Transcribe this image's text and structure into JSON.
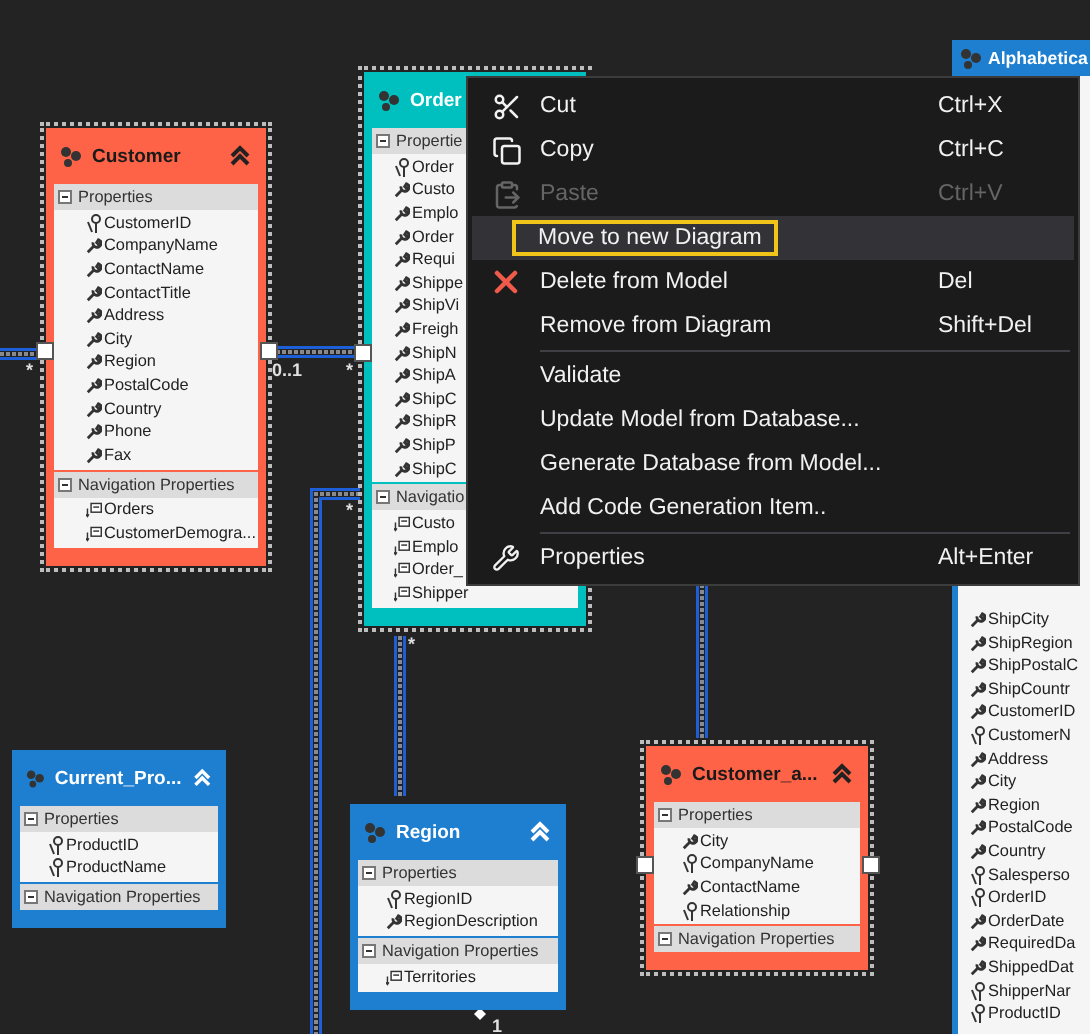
{
  "entities": [
    {
      "title": "Customer",
      "color": "#ff6347",
      "selected": true,
      "collapse_button": true,
      "sections": [
        {
          "label": "Properties",
          "rows": [
            {
              "text": "CustomerID",
              "kind": "key"
            },
            {
              "text": "CompanyName",
              "kind": "scalar"
            },
            {
              "text": "ContactName",
              "kind": "scalar"
            },
            {
              "text": "ContactTitle",
              "kind": "scalar"
            },
            {
              "text": "Address",
              "kind": "scalar"
            },
            {
              "text": "City",
              "kind": "scalar"
            },
            {
              "text": "Region",
              "kind": "scalar"
            },
            {
              "text": "PostalCode",
              "kind": "scalar"
            },
            {
              "text": "Country",
              "kind": "scalar"
            },
            {
              "text": "Phone",
              "kind": "scalar"
            },
            {
              "text": "Fax",
              "kind": "scalar"
            }
          ]
        },
        {
          "label": "Navigation Properties",
          "rows": [
            {
              "text": "Orders",
              "kind": "nav"
            },
            {
              "text": "CustomerDemogra...",
              "kind": "nav"
            }
          ]
        }
      ]
    },
    {
      "title": "Order",
      "color": "#00bfbf",
      "selected": true,
      "collapse_button": false,
      "sections": [
        {
          "label": "Propertie",
          "rows": [
            {
              "text": "Order",
              "kind": "key"
            },
            {
              "text": "Custo",
              "kind": "scalar"
            },
            {
              "text": "Emplo",
              "kind": "scalar"
            },
            {
              "text": "Order",
              "kind": "scalar"
            },
            {
              "text": "Requi",
              "kind": "scalar"
            },
            {
              "text": "Shippe",
              "kind": "scalar"
            },
            {
              "text": "ShipVi",
              "kind": "scalar"
            },
            {
              "text": "Freigh",
              "kind": "scalar"
            },
            {
              "text": "ShipN",
              "kind": "scalar"
            },
            {
              "text": "ShipA",
              "kind": "scalar"
            },
            {
              "text": "ShipC",
              "kind": "scalar"
            },
            {
              "text": "ShipR",
              "kind": "scalar"
            },
            {
              "text": "ShipP",
              "kind": "scalar"
            },
            {
              "text": "ShipC",
              "kind": "scalar"
            }
          ]
        },
        {
          "label": "Navigatio",
          "rows": [
            {
              "text": "Custo",
              "kind": "nav"
            },
            {
              "text": "Emplo",
              "kind": "nav"
            },
            {
              "text": "Order_",
              "kind": "nav"
            },
            {
              "text": "Shipper",
              "kind": "nav"
            }
          ]
        }
      ]
    },
    {
      "title": "Current_Pro...",
      "color": "#1e7fd0",
      "selected": false,
      "collapse_button": true,
      "sections": [
        {
          "label": "Properties",
          "rows": [
            {
              "text": "ProductID",
              "kind": "key"
            },
            {
              "text": "ProductName",
              "kind": "key"
            }
          ]
        },
        {
          "label": "Navigation Properties"
        }
      ]
    },
    {
      "title": "Region",
      "color": "#1e7fd0",
      "selected": false,
      "collapse_button": true,
      "sections": [
        {
          "label": "Properties",
          "rows": [
            {
              "text": "RegionID",
              "kind": "key"
            },
            {
              "text": "RegionDescription",
              "kind": "scalar"
            }
          ]
        },
        {
          "label": "Navigation Properties",
          "rows": [
            {
              "text": "Territories",
              "kind": "nav"
            }
          ]
        }
      ]
    },
    {
      "title": "Customer_a...",
      "color": "#ff6347",
      "selected": true,
      "collapse_button": true,
      "sections": [
        {
          "label": "Properties",
          "rows": [
            {
              "text": "City",
              "kind": "scalar"
            },
            {
              "text": "CompanyName",
              "kind": "key"
            },
            {
              "text": "ContactName",
              "kind": "scalar"
            },
            {
              "text": "Relationship",
              "kind": "key"
            }
          ]
        },
        {
          "label": "Navigation Properties"
        }
      ]
    }
  ],
  "side_entity": {
    "title": "Alphabetica",
    "color": "#1e7fd0",
    "rows": [
      {
        "text": "ShipCity",
        "kind": "scalar"
      },
      {
        "text": "ShipRegion",
        "kind": "scalar"
      },
      {
        "text": "ShipPostalC",
        "kind": "scalar"
      },
      {
        "text": "ShipCountr",
        "kind": "scalar"
      },
      {
        "text": "CustomerID",
        "kind": "scalar"
      },
      {
        "text": "CustomerN",
        "kind": "key"
      },
      {
        "text": "Address",
        "kind": "scalar"
      },
      {
        "text": "City",
        "kind": "scalar"
      },
      {
        "text": "Region",
        "kind": "scalar"
      },
      {
        "text": "PostalCode",
        "kind": "scalar"
      },
      {
        "text": "Country",
        "kind": "scalar"
      },
      {
        "text": "Salesperso",
        "kind": "key"
      },
      {
        "text": "OrderID",
        "kind": "key"
      },
      {
        "text": "OrderDate",
        "kind": "scalar"
      },
      {
        "text": "RequiredDa",
        "kind": "scalar"
      },
      {
        "text": "ShippedDat",
        "kind": "scalar"
      },
      {
        "text": "ShipperNar",
        "kind": "key"
      },
      {
        "text": "ProductID",
        "kind": "key"
      }
    ]
  },
  "connector_labels": [
    "*",
    "0..1",
    "*",
    "*",
    "*",
    "1"
  ],
  "context_menu": {
    "groups": [
      [
        {
          "label": "Cut",
          "shortcut": "Ctrl+X",
          "disabled": false,
          "selected": false
        },
        {
          "label": "Copy",
          "shortcut": "Ctrl+C",
          "disabled": false,
          "selected": false
        },
        {
          "label": "Paste",
          "shortcut": "Ctrl+V",
          "disabled": true,
          "selected": false
        },
        {
          "label": "Move to new Diagram",
          "disabled": false,
          "selected": true
        },
        {
          "label": "Delete from Model",
          "shortcut": "Del",
          "disabled": false,
          "selected": false
        },
        {
          "label": "Remove from Diagram",
          "shortcut": "Shift+Del",
          "disabled": false,
          "selected": false
        }
      ],
      [
        {
          "label": "Validate",
          "disabled": false,
          "selected": false
        },
        {
          "label": "Update Model from Database...",
          "disabled": false,
          "selected": false
        },
        {
          "label": "Generate Database from Model...",
          "disabled": false,
          "selected": false
        },
        {
          "label": "Add Code Generation Item..",
          "disabled": false,
          "selected": false
        }
      ],
      [
        {
          "label": "Properties",
          "shortcut": "Alt+Enter",
          "disabled": false,
          "selected": false
        }
      ]
    ]
  }
}
